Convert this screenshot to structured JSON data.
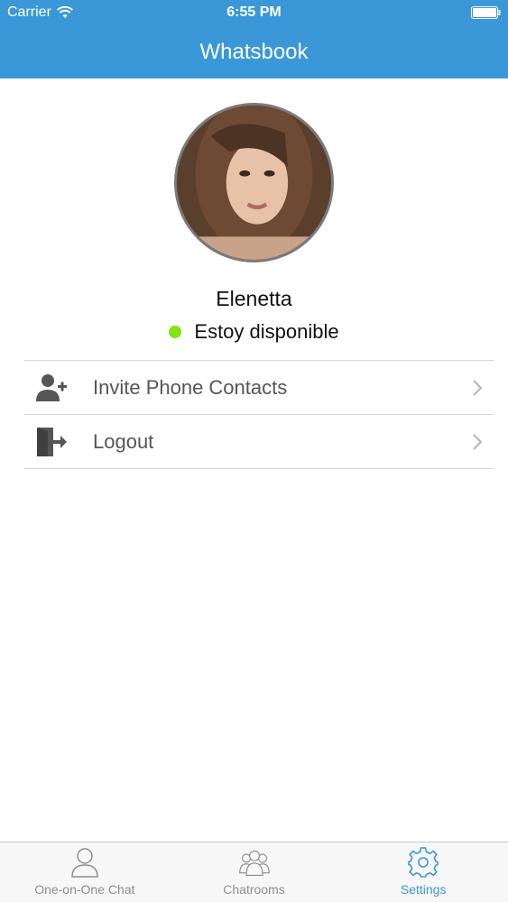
{
  "status_bar": {
    "carrier": "Carrier",
    "time": "6:55 PM",
    "icons": [
      "wifi-icon",
      "battery-icon"
    ]
  },
  "nav": {
    "title": "Whatsbook"
  },
  "profile": {
    "name": "Elenetta",
    "status_text": "Estoy disponible",
    "status_color": "#7ee50e"
  },
  "menu": {
    "items": [
      {
        "label": "Invite Phone Contacts",
        "icon": "add-user-icon"
      },
      {
        "label": "Logout",
        "icon": "logout-icon"
      }
    ]
  },
  "tab_bar": {
    "tabs": [
      {
        "label": "One-on-One Chat",
        "icon": "person-icon",
        "active": false
      },
      {
        "label": "Chatrooms",
        "icon": "group-icon",
        "active": false
      },
      {
        "label": "Settings",
        "icon": "gear-icon",
        "active": true
      }
    ]
  },
  "colors": {
    "accent": "#3a98d8",
    "header_text": "#ffffff",
    "inactive_tab": "#8e8e8e",
    "divider": "#d6d6d6"
  }
}
